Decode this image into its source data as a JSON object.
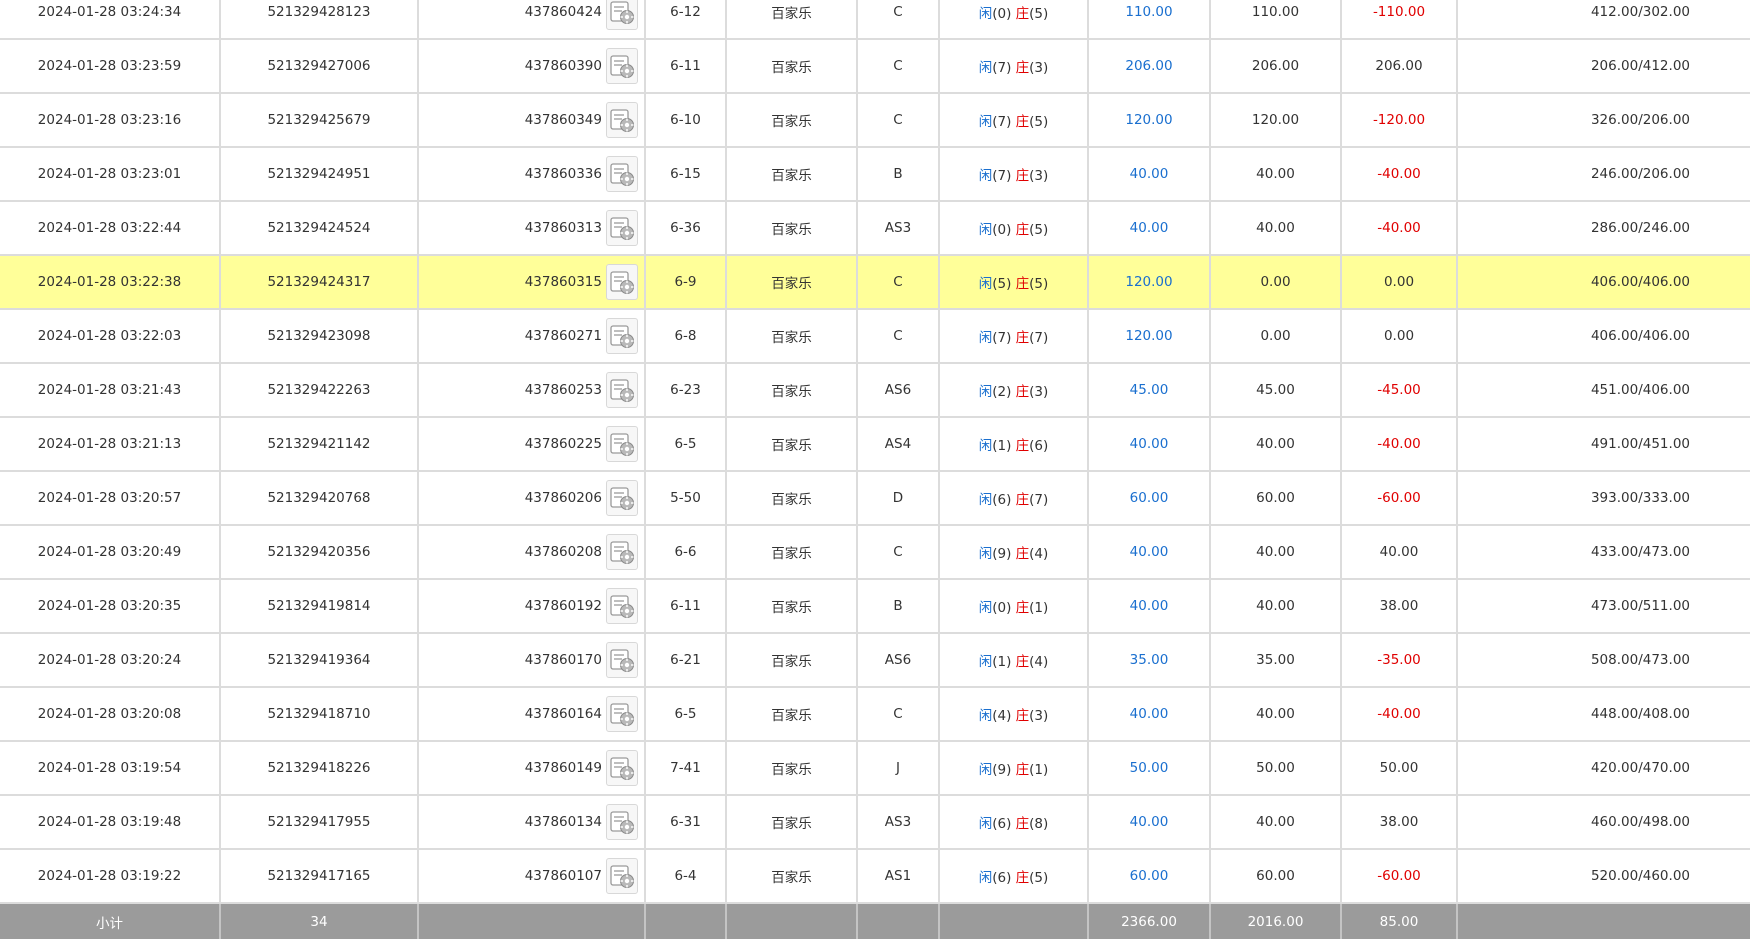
{
  "rows": [
    {
      "time": "2024-01-28 03:24:34",
      "bet_id": "521329428123",
      "round_id": "437860424",
      "table": "6-12",
      "game": "百家乐",
      "bet_type": "C",
      "player": "闲",
      "player_score": "(0)",
      "banker": "庄",
      "banker_score": "(5)",
      "bet_amount": "110.00",
      "valid_amount": "110.00",
      "win_loss": "-110.00",
      "win_loss_color": "red",
      "balance": "412.00/302.00",
      "highlight": false
    },
    {
      "time": "2024-01-28 03:23:59",
      "bet_id": "521329427006",
      "round_id": "437860390",
      "table": "6-11",
      "game": "百家乐",
      "bet_type": "C",
      "player": "闲",
      "player_score": "(7)",
      "banker": "庄",
      "banker_score": "(3)",
      "bet_amount": "206.00",
      "valid_amount": "206.00",
      "win_loss": "206.00",
      "win_loss_color": "normal",
      "balance": "206.00/412.00",
      "highlight": false
    },
    {
      "time": "2024-01-28 03:23:16",
      "bet_id": "521329425679",
      "round_id": "437860349",
      "table": "6-10",
      "game": "百家乐",
      "bet_type": "C",
      "player": "闲",
      "player_score": "(7)",
      "banker": "庄",
      "banker_score": "(5)",
      "bet_amount": "120.00",
      "valid_amount": "120.00",
      "win_loss": "-120.00",
      "win_loss_color": "red",
      "balance": "326.00/206.00",
      "highlight": false
    },
    {
      "time": "2024-01-28 03:23:01",
      "bet_id": "521329424951",
      "round_id": "437860336",
      "table": "6-15",
      "game": "百家乐",
      "bet_type": "B",
      "player": "闲",
      "player_score": "(7)",
      "banker": "庄",
      "banker_score": "(3)",
      "bet_amount": "40.00",
      "valid_amount": "40.00",
      "win_loss": "-40.00",
      "win_loss_color": "red",
      "balance": "246.00/206.00",
      "highlight": false
    },
    {
      "time": "2024-01-28 03:22:44",
      "bet_id": "521329424524",
      "round_id": "437860313",
      "table": "6-36",
      "game": "百家乐",
      "bet_type": "AS3",
      "player": "闲",
      "player_score": "(0)",
      "banker": "庄",
      "banker_score": "(5)",
      "bet_amount": "40.00",
      "valid_amount": "40.00",
      "win_loss": "-40.00",
      "win_loss_color": "red",
      "balance": "286.00/246.00",
      "highlight": false
    },
    {
      "time": "2024-01-28 03:22:38",
      "bet_id": "521329424317",
      "round_id": "437860315",
      "table": "6-9",
      "game": "百家乐",
      "bet_type": "C",
      "player": "闲",
      "player_score": "(5)",
      "banker": "庄",
      "banker_score": "(5)",
      "bet_amount": "120.00",
      "valid_amount": "0.00",
      "win_loss": "0.00",
      "win_loss_color": "normal",
      "balance": "406.00/406.00",
      "highlight": true
    },
    {
      "time": "2024-01-28 03:22:03",
      "bet_id": "521329423098",
      "round_id": "437860271",
      "table": "6-8",
      "game": "百家乐",
      "bet_type": "C",
      "player": "闲",
      "player_score": "(7)",
      "banker": "庄",
      "banker_score": "(7)",
      "bet_amount": "120.00",
      "valid_amount": "0.00",
      "win_loss": "0.00",
      "win_loss_color": "normal",
      "balance": "406.00/406.00",
      "highlight": false
    },
    {
      "time": "2024-01-28 03:21:43",
      "bet_id": "521329422263",
      "round_id": "437860253",
      "table": "6-23",
      "game": "百家乐",
      "bet_type": "AS6",
      "player": "闲",
      "player_score": "(2)",
      "banker": "庄",
      "banker_score": "(3)",
      "bet_amount": "45.00",
      "valid_amount": "45.00",
      "win_loss": "-45.00",
      "win_loss_color": "red",
      "balance": "451.00/406.00",
      "highlight": false
    },
    {
      "time": "2024-01-28 03:21:13",
      "bet_id": "521329421142",
      "round_id": "437860225",
      "table": "6-5",
      "game": "百家乐",
      "bet_type": "AS4",
      "player": "闲",
      "player_score": "(1)",
      "banker": "庄",
      "banker_score": "(6)",
      "bet_amount": "40.00",
      "valid_amount": "40.00",
      "win_loss": "-40.00",
      "win_loss_color": "red",
      "balance": "491.00/451.00",
      "highlight": false
    },
    {
      "time": "2024-01-28 03:20:57",
      "bet_id": "521329420768",
      "round_id": "437860206",
      "table": "5-50",
      "game": "百家乐",
      "bet_type": "D",
      "player": "闲",
      "player_score": "(6)",
      "banker": "庄",
      "banker_score": "(7)",
      "bet_amount": "60.00",
      "valid_amount": "60.00",
      "win_loss": "-60.00",
      "win_loss_color": "red",
      "balance": "393.00/333.00",
      "highlight": false
    },
    {
      "time": "2024-01-28 03:20:49",
      "bet_id": "521329420356",
      "round_id": "437860208",
      "table": "6-6",
      "game": "百家乐",
      "bet_type": "C",
      "player": "闲",
      "player_score": "(9)",
      "banker": "庄",
      "banker_score": "(4)",
      "bet_amount": "40.00",
      "valid_amount": "40.00",
      "win_loss": "40.00",
      "win_loss_color": "normal",
      "balance": "433.00/473.00",
      "highlight": false
    },
    {
      "time": "2024-01-28 03:20:35",
      "bet_id": "521329419814",
      "round_id": "437860192",
      "table": "6-11",
      "game": "百家乐",
      "bet_type": "B",
      "player": "闲",
      "player_score": "(0)",
      "banker": "庄",
      "banker_score": "(1)",
      "bet_amount": "40.00",
      "valid_amount": "40.00",
      "win_loss": "38.00",
      "win_loss_color": "normal",
      "balance": "473.00/511.00",
      "highlight": false
    },
    {
      "time": "2024-01-28 03:20:24",
      "bet_id": "521329419364",
      "round_id": "437860170",
      "table": "6-21",
      "game": "百家乐",
      "bet_type": "AS6",
      "player": "闲",
      "player_score": "(1)",
      "banker": "庄",
      "banker_score": "(4)",
      "bet_amount": "35.00",
      "valid_amount": "35.00",
      "win_loss": "-35.00",
      "win_loss_color": "red",
      "balance": "508.00/473.00",
      "highlight": false
    },
    {
      "time": "2024-01-28 03:20:08",
      "bet_id": "521329418710",
      "round_id": "437860164",
      "table": "6-5",
      "game": "百家乐",
      "bet_type": "C",
      "player": "闲",
      "player_score": "(4)",
      "banker": "庄",
      "banker_score": "(3)",
      "bet_amount": "40.00",
      "valid_amount": "40.00",
      "win_loss": "-40.00",
      "win_loss_color": "red",
      "balance": "448.00/408.00",
      "highlight": false
    },
    {
      "time": "2024-01-28 03:19:54",
      "bet_id": "521329418226",
      "round_id": "437860149",
      "table": "7-41",
      "game": "百家乐",
      "bet_type": "J",
      "player": "闲",
      "player_score": "(9)",
      "banker": "庄",
      "banker_score": "(1)",
      "bet_amount": "50.00",
      "valid_amount": "50.00",
      "win_loss": "50.00",
      "win_loss_color": "normal",
      "balance": "420.00/470.00",
      "highlight": false
    },
    {
      "time": "2024-01-28 03:19:48",
      "bet_id": "521329417955",
      "round_id": "437860134",
      "table": "6-31",
      "game": "百家乐",
      "bet_type": "AS3",
      "player": "闲",
      "player_score": "(6)",
      "banker": "庄",
      "banker_score": "(8)",
      "bet_amount": "40.00",
      "valid_amount": "40.00",
      "win_loss": "38.00",
      "win_loss_color": "normal",
      "balance": "460.00/498.00",
      "highlight": false
    },
    {
      "time": "2024-01-28 03:19:22",
      "bet_id": "521329417165",
      "round_id": "437860107",
      "table": "6-4",
      "game": "百家乐",
      "bet_type": "AS1",
      "player": "闲",
      "player_score": "(6)",
      "banker": "庄",
      "banker_score": "(5)",
      "bet_amount": "60.00",
      "valid_amount": "60.00",
      "win_loss": "-60.00",
      "win_loss_color": "red",
      "balance": "520.00/460.00",
      "highlight": false
    }
  ],
  "subtotal": {
    "label": "小计",
    "count": "34",
    "bet_amount": "2366.00",
    "valid_amount": "2016.00",
    "win_loss": "85.00"
  },
  "colors": {
    "player": "#1a6fcf",
    "banker": "#e00000",
    "highlight": "#ffff99",
    "footer": "#9b9b9b"
  },
  "icons": {
    "ticket": "card-table-icon"
  }
}
